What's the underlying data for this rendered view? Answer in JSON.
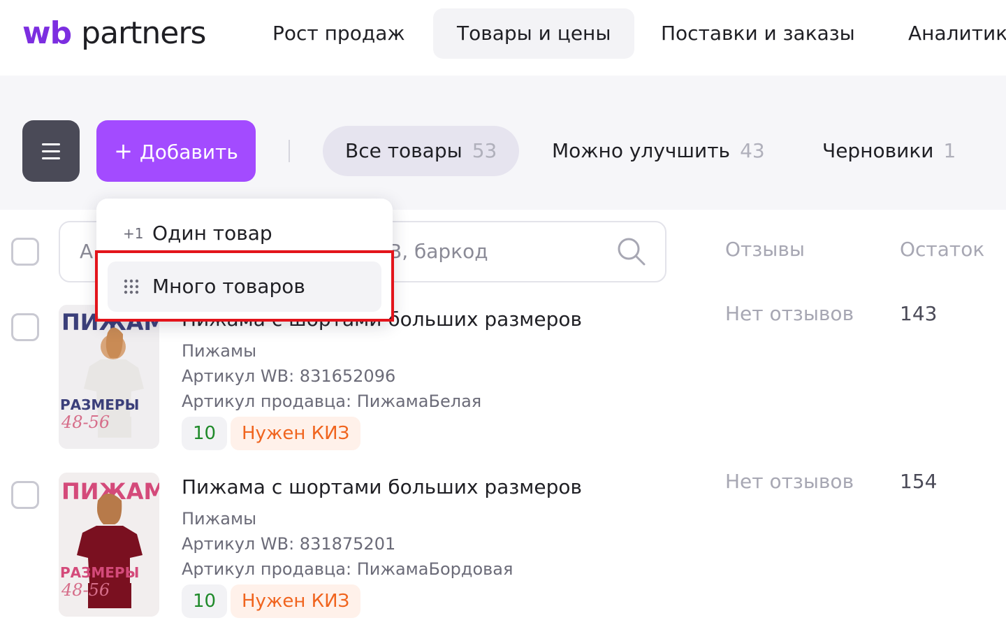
{
  "header": {
    "logo_wb": "wb",
    "logo_partners": "partners",
    "nav": [
      {
        "label": "Рост продаж",
        "active": false
      },
      {
        "label": "Товары и цены",
        "active": true
      },
      {
        "label": "Поставки и заказы",
        "active": false
      },
      {
        "label": "Аналитик",
        "active": false
      }
    ]
  },
  "toolbar": {
    "menu_icon": "hamburger-icon",
    "add_label": "Добавить",
    "add_icon": "plus-icon",
    "filters": [
      {
        "label": "Все товары",
        "count": "53",
        "active": true
      },
      {
        "label": "Можно улучшить",
        "count": "43",
        "active": false
      },
      {
        "label": "Черновики",
        "count": "1",
        "active": false
      }
    ]
  },
  "dropdown": {
    "items": [
      {
        "icon_text": "+1",
        "icon": "plus-one-icon",
        "label": "Один товар"
      },
      {
        "icon": "grid-dots-icon",
        "label": "Много товаров",
        "highlighted": true
      }
    ]
  },
  "search": {
    "visible_start": "А",
    "visible_end": "В, баркод",
    "icon": "search-icon"
  },
  "columns": {
    "reviews": "Отзывы",
    "stock": "Остаток"
  },
  "products": [
    {
      "title": "Пижама с шортами больших размеров",
      "category": "Пижамы",
      "wb_article": "Артикул WB: 831652096",
      "seller_article": "Артикул продавца: ПижамаБелая",
      "count_chip": "10",
      "kiz_chip": "Нужен КИЗ",
      "reviews": "Нет отзывов",
      "stock": "143",
      "thumb_top": "ПИЖАМА",
      "thumb_sizes": "РАЗМЕРЫ",
      "thumb_range": "48-56",
      "garment_color": "#e8e6e4"
    },
    {
      "title": "Пижама с шортами больших размеров",
      "category": "Пижамы",
      "wb_article": "Артикул WB: 831875201",
      "seller_article": "Артикул продавца: ПижамаБордовая",
      "count_chip": "10",
      "kiz_chip": "Нужен КИЗ",
      "reviews": "Нет отзывов",
      "stock": "154",
      "thumb_top": "ПИЖАМА",
      "thumb_sizes": "РАЗМЕРЫ",
      "thumb_range": "48-56",
      "garment_color": "#7a1020"
    }
  ],
  "colors": {
    "accent": "#a34bff",
    "brand_purple": "#7c2ee0",
    "highlight_red": "#e3141b",
    "kiz_orange": "#f0641e",
    "count_green": "#1f8a2a"
  }
}
